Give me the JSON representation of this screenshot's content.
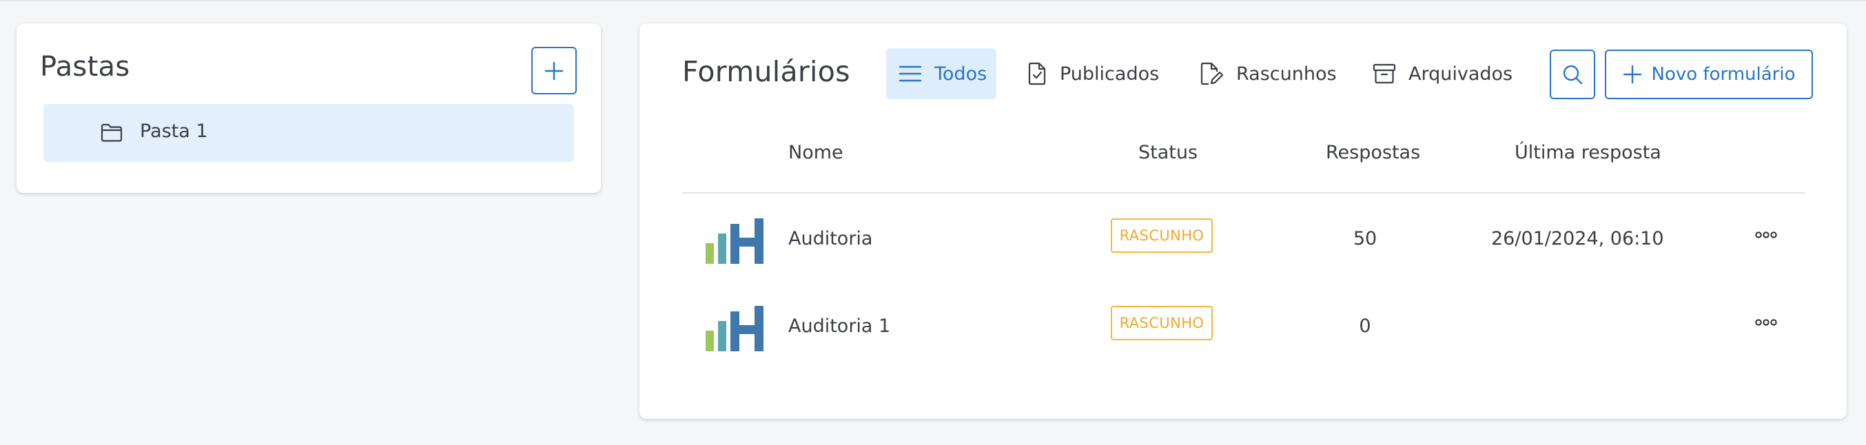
{
  "folders": {
    "title": "Pastas",
    "add_icon": "plus-icon",
    "items": [
      {
        "label": "Pasta 1",
        "icon": "folder-icon"
      }
    ]
  },
  "forms": {
    "title": "Formulários",
    "tabs": [
      {
        "label": "Todos",
        "icon": "list-icon",
        "active": true
      },
      {
        "label": "Publicados",
        "icon": "file-check-icon"
      },
      {
        "label": "Rascunhos",
        "icon": "file-edit-icon"
      },
      {
        "label": "Arquivados",
        "icon": "archive-icon"
      }
    ],
    "search_icon": "search-icon",
    "new_form_label": "Novo formulário",
    "columns": {
      "name": "Nome",
      "status": "Status",
      "responses": "Respostas",
      "last_response": "Última resposta"
    },
    "rows": [
      {
        "name": "Auditoria",
        "status": "RASCUNHO",
        "responses": "50",
        "last_response": "26/01/2024, 06:10"
      },
      {
        "name": "Auditoria 1",
        "status": "RASCUNHO",
        "responses": "0",
        "last_response": ""
      }
    ]
  },
  "colors": {
    "accent": "#2a74c9",
    "active_tab_bg": "#deedfb",
    "folder_selected_bg": "#e3f0fb",
    "draft_badge": "#f4b73a",
    "logo_green": "#9cc85a",
    "logo_teal": "#5aa6b0",
    "logo_blue": "#3f78ad"
  }
}
